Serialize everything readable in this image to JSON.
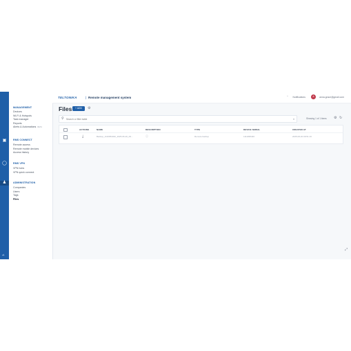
{
  "rail": {
    "icons": [
      "chart-icon",
      "devices-icon",
      "connect-icon",
      "admin-icon"
    ],
    "footer": "v4"
  },
  "nav": {
    "sections": [
      {
        "title": "MANAGEMENT",
        "items": [
          "Devices",
          "Wi-Fi & Hotspots",
          "Task manager",
          "Reports",
          "Alerts & Automations"
        ]
      },
      {
        "title": "RMS CONNECT",
        "items": [
          "Remote access",
          "Remote mobile devices",
          "Access history"
        ]
      },
      {
        "title": "RMS VPN",
        "items": [
          "VPN hubs",
          "VPN quick connect"
        ]
      },
      {
        "title": "ADMINISTRATION",
        "items": [
          "Companies",
          "Users",
          "Tags",
          "Files"
        ]
      }
    ],
    "beta": "BETA",
    "selected": "Files"
  },
  "topbar": {
    "logo": "TELTONIKA",
    "separator": "|",
    "title": "Remote management system",
    "notifications": "Notifications",
    "avatar": "A",
    "email": "anna.grace@gmail.com"
  },
  "page": {
    "title": "Files",
    "add_label": "+ ADD",
    "search_placeholder": "Search or filter table",
    "showing": "Showing 1 of 1 items"
  },
  "table": {
    "columns": [
      "ACTIONS",
      "NAME",
      "DESCRIPTION",
      "TYPE",
      "DEVICE SERIAL",
      "CREATED AT"
    ],
    "rows": [
      {
        "name": "Backup_1110954462_2025-06-20_09…",
        "type": "Remote backup",
        "serial": "1111095446",
        "created": "2025-06-20 09:51:16"
      }
    ]
  },
  "colors": {
    "primary": "#1f5fa8",
    "rail": "#1f5fa8",
    "avatar": "#c0394b"
  }
}
